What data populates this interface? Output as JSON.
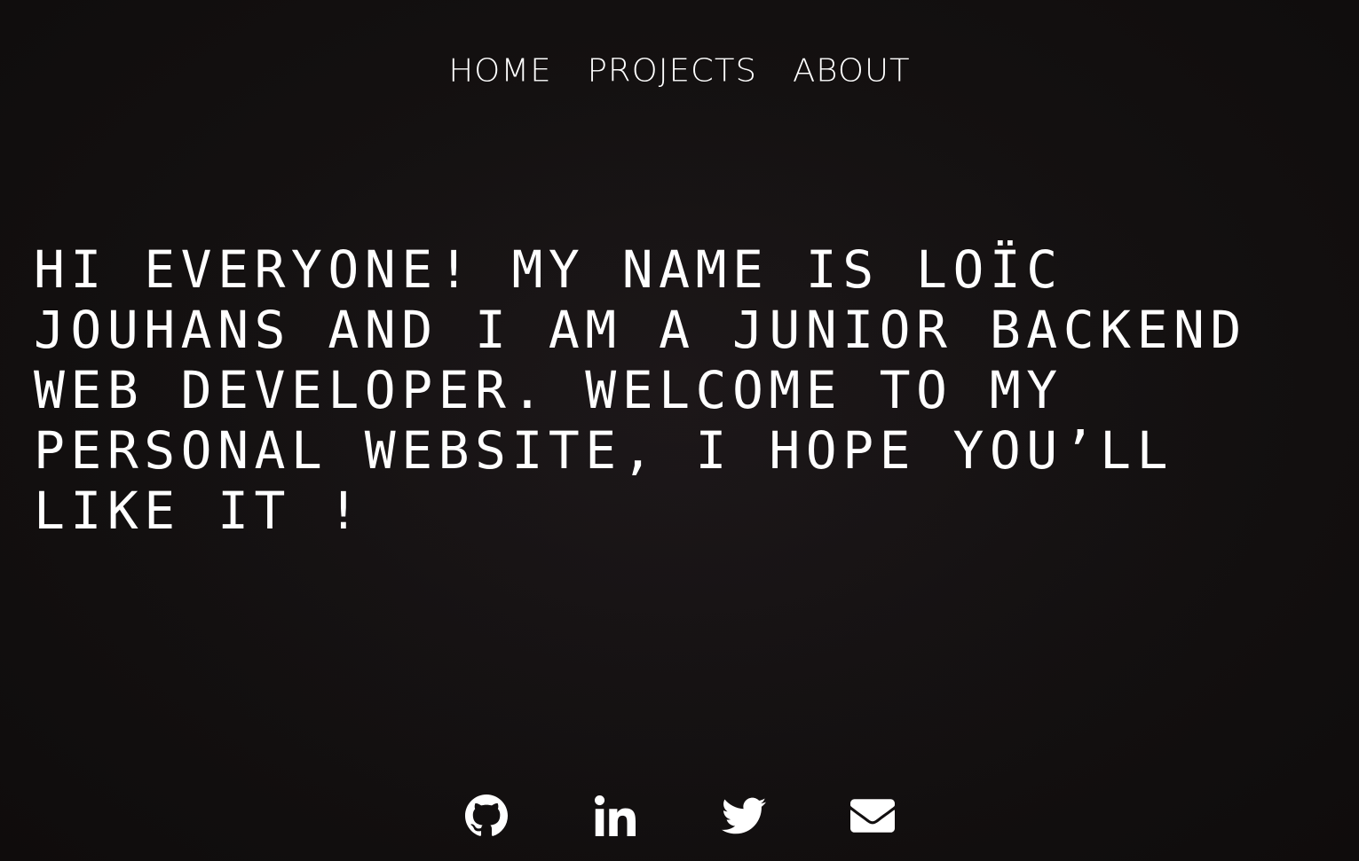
{
  "nav": {
    "items": [
      {
        "label": "HOME"
      },
      {
        "label": "PROJECTS"
      },
      {
        "label": "ABOUT"
      }
    ]
  },
  "hero": {
    "text": "HI EVERYONE! MY NAME IS LOÏC JOUHANS AND I AM A JUNIOR BACKEND WEB DEVELOPER. WELCOME TO MY PERSONAL WEBSITE, I HOPE YOU’LL LIKE IT !"
  },
  "socials": [
    {
      "icon": "github-icon"
    },
    {
      "icon": "linkedin-icon"
    },
    {
      "icon": "twitter-icon"
    },
    {
      "icon": "envelope-icon"
    }
  ],
  "colors": {
    "background": "#120f0f",
    "text": "#ffffff"
  }
}
